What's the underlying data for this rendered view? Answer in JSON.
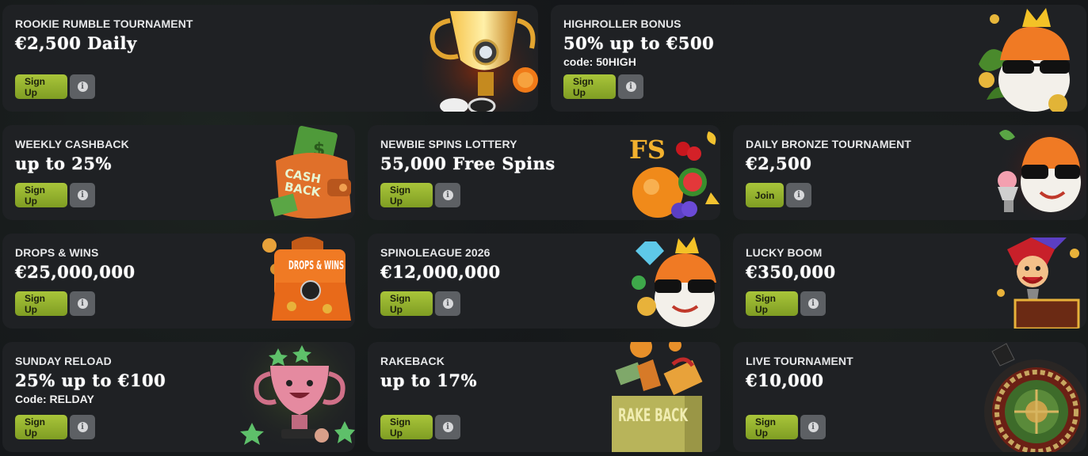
{
  "info_glyph": "i",
  "cards": [
    {
      "title": "ROOKIE RUMBLE TOURNAMENT",
      "amount": "€2,500 Daily",
      "button": "Sign Up",
      "art": "golden-trophy-icon"
    },
    {
      "title": "HIGHROLLER BONUS",
      "amount": "50% up to €500",
      "code": "code: 50HIGH",
      "button": "Sign Up",
      "art": "sushi-king-mascot-icon"
    },
    {
      "title": "WEEKLY CASHBACK",
      "amount": "up to 25%",
      "button": "Sign Up",
      "art": "cashback-wallet-icon"
    },
    {
      "title": "NEWBIE SPINS LOTTERY",
      "amount": "55,000 Free Spins",
      "button": "Sign Up",
      "art": "fruits-free-spins-icon",
      "art_text": "FS"
    },
    {
      "title": "DAILY BRONZE TOURNAMENT",
      "amount": "€2,500",
      "button": "Join",
      "art": "sushi-mascot-trophy-icon"
    },
    {
      "title": "DROPS & WINS",
      "amount": "€25,000,000",
      "button": "Sign Up",
      "art": "drops-wins-case-icon",
      "art_text": "DROPS & WINS"
    },
    {
      "title": "SPINOLEAGUE 2026",
      "amount": "€12,000,000",
      "button": "Sign Up",
      "art": "sushi-king-diamond-icon"
    },
    {
      "title": "LUCKY BOOM",
      "amount": "€350,000",
      "button": "Sign Up",
      "art": "jester-box-icon"
    },
    {
      "title": "SUNDAY RELOAD",
      "amount": "25% up to €100",
      "code": "Code: RELDAY",
      "button": "Sign Up",
      "art": "pink-trophy-icon"
    },
    {
      "title": "RAKEBACK",
      "amount": "up to 17%",
      "button": "Sign Up",
      "art": "rakeback-gift-icon",
      "art_text": "RAKE BACK"
    },
    {
      "title": "LIVE TOURNAMENT",
      "amount": "€10,000",
      "button": "Sign Up",
      "art": "roulette-wheel-icon"
    }
  ],
  "colors": {
    "page_bg": "#15171a",
    "card_bg": "#1f2124",
    "button_green": "#98b52f",
    "info_gray": "#5d6064"
  }
}
